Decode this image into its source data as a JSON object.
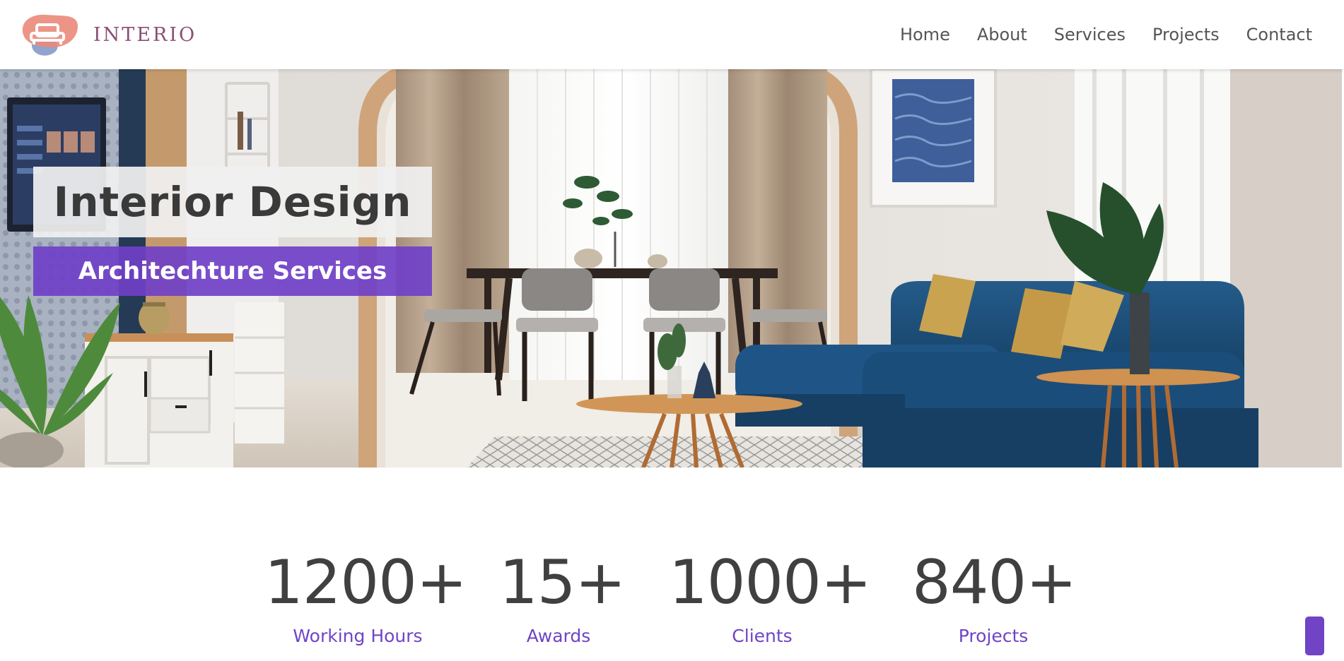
{
  "brand": {
    "name": "INTERIO",
    "logo_icon": "sofa-logo-icon"
  },
  "nav": {
    "items": [
      "Home",
      "About",
      "Services",
      "Projects",
      "Contact"
    ]
  },
  "hero": {
    "title": "Interior Design",
    "subtitle": "Architechture Services"
  },
  "stats": [
    {
      "value": "1200+",
      "label": "Working Hours"
    },
    {
      "value": "15+",
      "label": "Awards"
    },
    {
      "value": "1000+",
      "label": "Clients"
    },
    {
      "value": "840+",
      "label": "Projects"
    }
  ],
  "colors": {
    "accent": "#7044c4",
    "brand_text": "#8a4f75",
    "sofa_blue": "#1d4f7a",
    "wood": "#c9803f"
  }
}
